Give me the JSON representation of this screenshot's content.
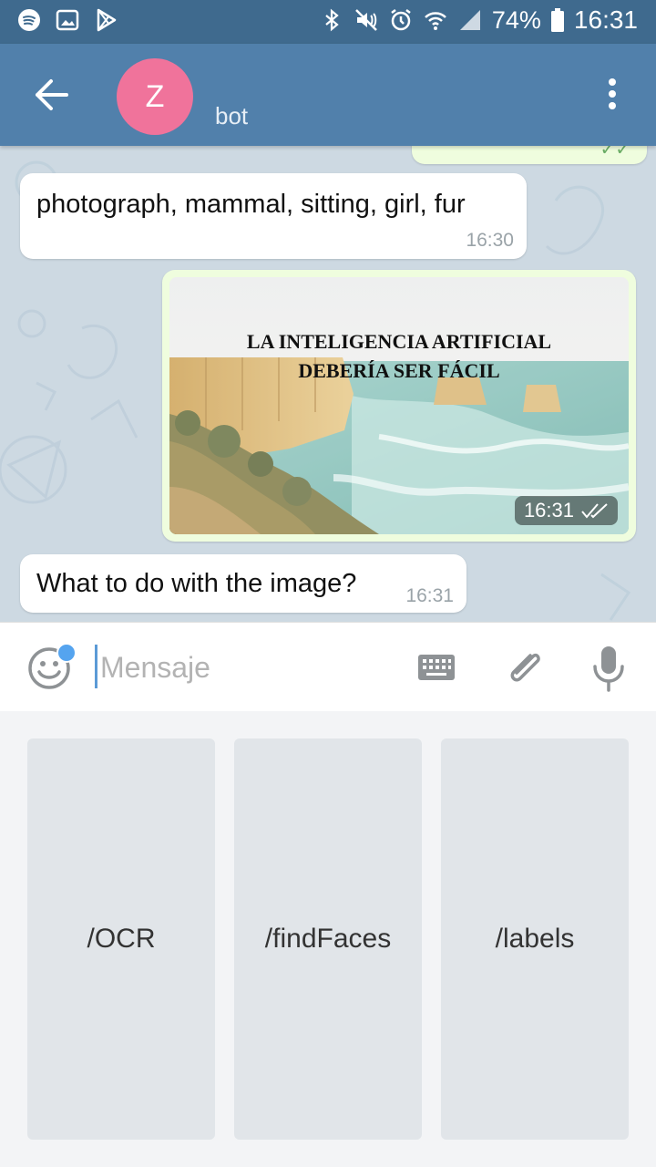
{
  "status_bar": {
    "battery": "74%",
    "time": "16:31"
  },
  "header": {
    "avatar_letter": "Z",
    "chat_name": "bot",
    "avatar_color": "#f0739b",
    "bar_color": "#5180ab"
  },
  "messages": [
    {
      "text": "photograph, mammal, sitting, girl, fur",
      "time": "16:30",
      "direction": "in"
    },
    {
      "type": "photo",
      "caption_line1": "LA INTELIGENCIA ARTIFICIAL",
      "caption_line2": "DEBERÍA SER FÁCIL",
      "time": "16:31",
      "direction": "out"
    },
    {
      "text": "What to do with the image?",
      "time": "16:31",
      "direction": "in"
    }
  ],
  "input": {
    "placeholder": "Mensaje"
  },
  "bot_keyboard": {
    "buttons": [
      "/OCR",
      "/findFaces",
      "/labels"
    ]
  }
}
